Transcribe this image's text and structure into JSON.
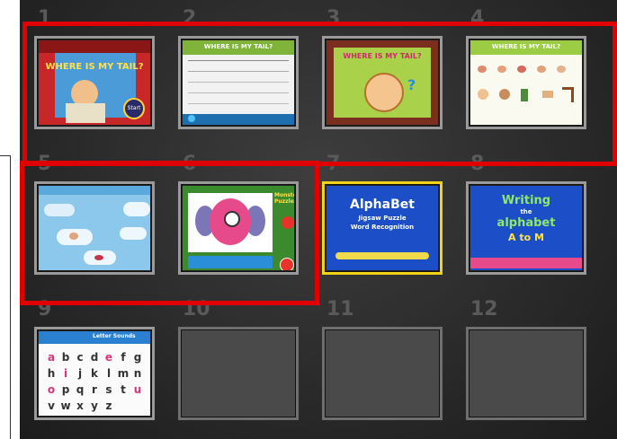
{
  "slots": [
    {
      "number": "1",
      "state": "filled",
      "name": "Where Is My Tail - title screen",
      "text": "WHERE IS MY TAIL?",
      "button": "Start"
    },
    {
      "number": "2",
      "state": "filled",
      "name": "Where Is My Tail - checklist",
      "text": "WHERE IS MY TAIL?"
    },
    {
      "number": "3",
      "state": "filled",
      "name": "Where Is My Tail - face",
      "text": "WHERE IS MY TAIL?"
    },
    {
      "number": "4",
      "state": "filled",
      "name": "Where Is My Tail - body parts",
      "text": "WHERE IS MY TAIL?"
    },
    {
      "number": "5",
      "state": "filled",
      "name": "Clouds body parts"
    },
    {
      "number": "6",
      "state": "filled",
      "name": "Monster face puzzle",
      "text": "Monster Puzzle"
    },
    {
      "number": "7",
      "state": "filled",
      "name": "Alphabet jigsaw",
      "title": "AlphaBet",
      "subtitle": "Jigsaw Puzzle",
      "subtitle2": "Word Recognition"
    },
    {
      "number": "8",
      "state": "filled",
      "name": "Writing the alphabet",
      "title": "Writing",
      "subtitle": "the",
      "title2": "alphabet",
      "title3": "A to M"
    },
    {
      "number": "9",
      "state": "filled",
      "name": "Letter sounds keyboard",
      "header": "Letter Sounds",
      "letters": [
        "a",
        "b",
        "c",
        "d",
        "e",
        "f",
        "g",
        "h",
        "i",
        "j",
        "k",
        "l",
        "m",
        "n",
        "o",
        "p",
        "q",
        "r",
        "s",
        "t",
        "u",
        "v",
        "w",
        "x",
        "y",
        "z"
      ]
    },
    {
      "number": "10",
      "state": "empty"
    },
    {
      "number": "11",
      "state": "empty"
    },
    {
      "number": "12",
      "state": "empty"
    }
  ],
  "colors": {
    "highlight": "#e10000",
    "selected": "#f3d21a"
  }
}
